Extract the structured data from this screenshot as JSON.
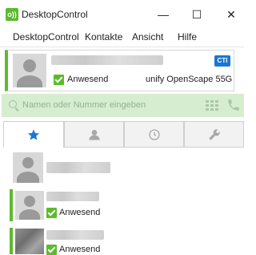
{
  "window": {
    "title": "DesktopControl",
    "app_icon_text": "o))",
    "minimize_glyph": "—",
    "maximize_glyph": "☐",
    "close_glyph": "✕"
  },
  "menu": {
    "items": [
      "DesktopControl",
      "Kontakte",
      "Ansicht",
      "Hilfe"
    ]
  },
  "self_card": {
    "status": "Anwesend",
    "device": "unify OpenScape 55G",
    "badge": "CTI"
  },
  "search": {
    "placeholder": "Namen oder Nummer eingeben"
  },
  "tabs": [
    {
      "icon": "star-icon",
      "active": true
    },
    {
      "icon": "person-icon",
      "active": false
    },
    {
      "icon": "clock-icon",
      "active": false
    },
    {
      "icon": "wrench-icon",
      "active": false
    }
  ],
  "contacts": [
    {
      "status": ""
    },
    {
      "status": "Anwesend"
    },
    {
      "status": "Anwesend"
    }
  ],
  "colors": {
    "accent_green": "#5cbb2d",
    "tab_active_blue": "#1a76d2",
    "search_bg": "#d7edd0"
  }
}
